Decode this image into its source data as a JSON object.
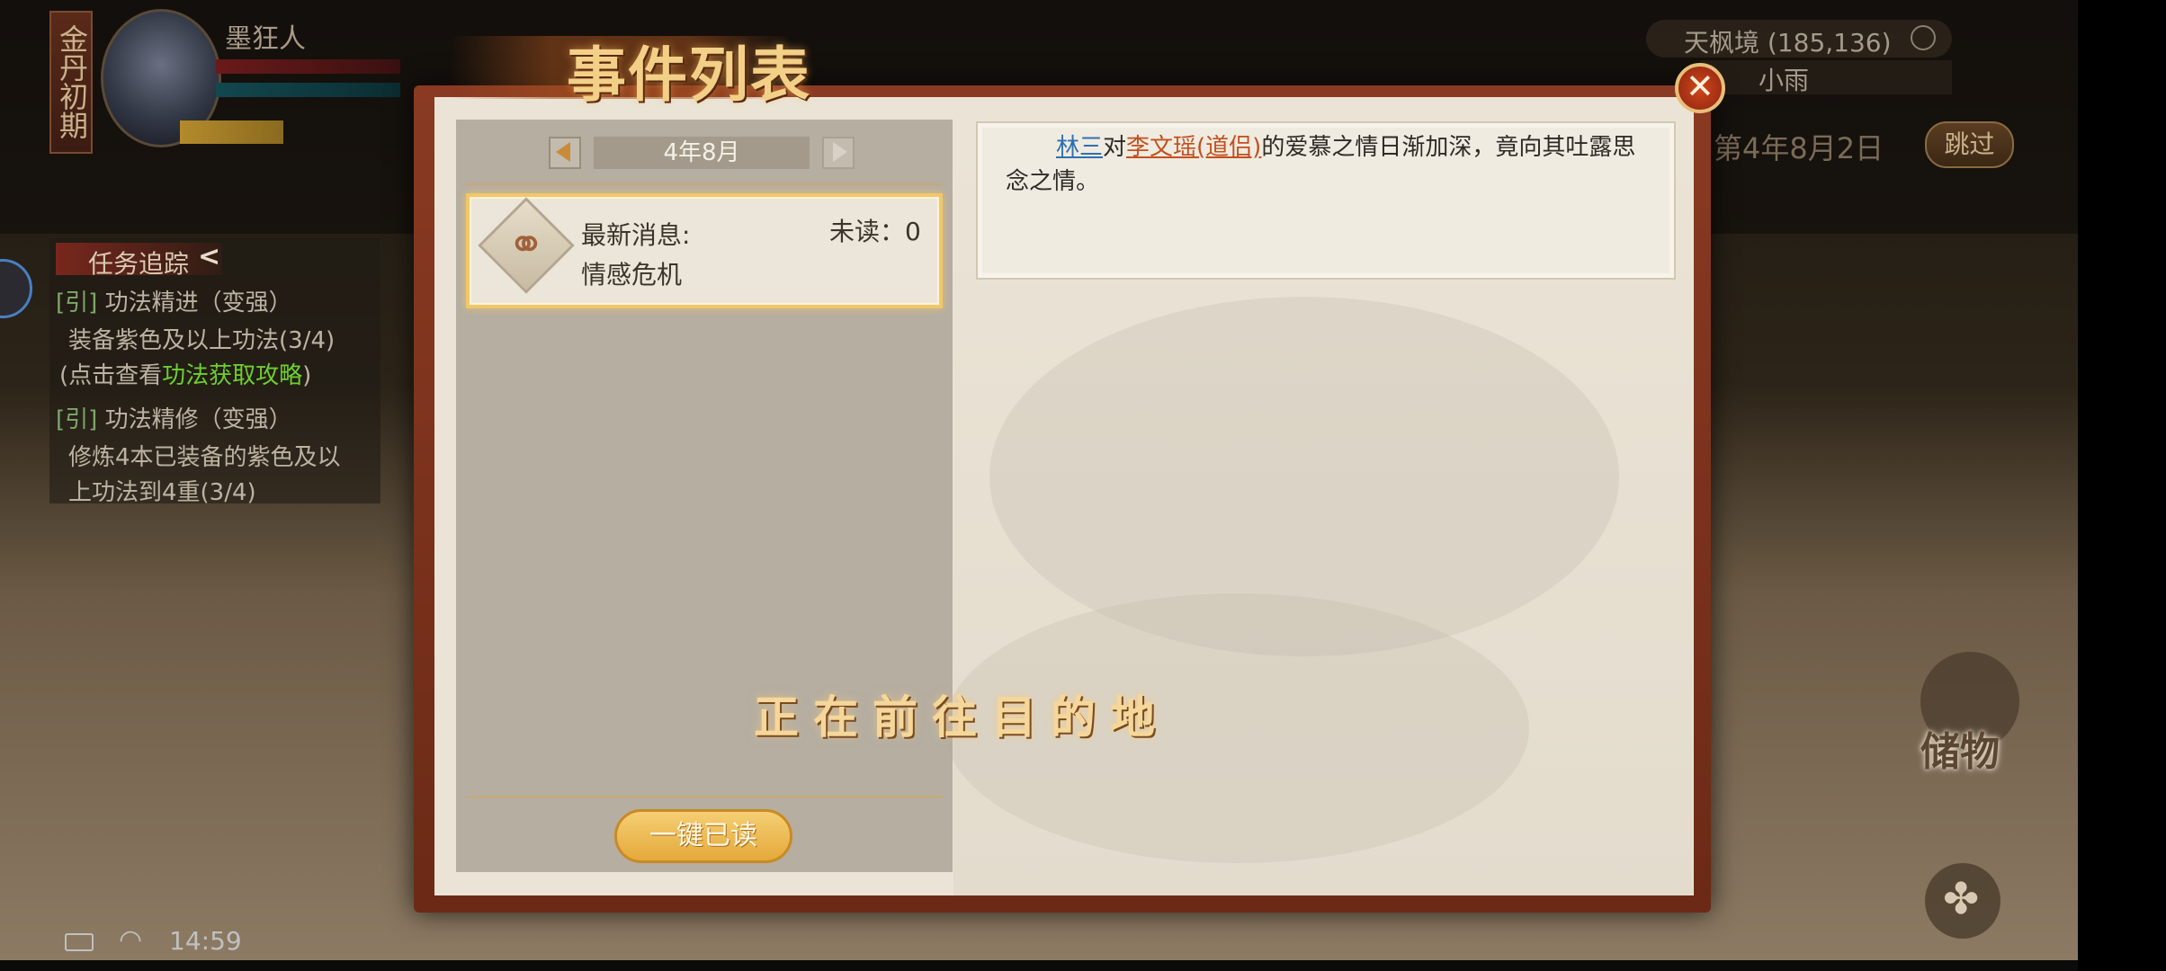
{
  "player": {
    "realm": "金丹初期",
    "name": "墨狂人"
  },
  "quests": {
    "title": "任务追踪",
    "items": [
      {
        "tag": "[引]",
        "name": "功法精进（变强）",
        "desc": "装备紫色及以上功法(3/4)",
        "hint_prefix": "(点击查看",
        "hint_link": "功法获取攻略",
        "hint_suffix": ")"
      },
      {
        "tag": "[引]",
        "name": "功法精修（变强）",
        "desc_line1": "修炼4本已装备的紫色及以",
        "desc_line2": "上功法到4重(3/4)"
      }
    ]
  },
  "hud": {
    "location": "天枫境 (185,136)",
    "weather": "小雨",
    "date": "第4年8月2日",
    "skip_label": "跳过",
    "storage_label": "储物"
  },
  "dialog": {
    "title": "事件列表",
    "month": "4年8月",
    "event": {
      "latest_label": "最新消息:",
      "unread_label": "未读：0",
      "name": "情感危机",
      "icon": "couple-icon"
    },
    "mark_all_read_label": "一键已读",
    "message": {
      "name1": "林三",
      "connector": "对",
      "name2": "李文瑶(道侣)",
      "rest": "的爱慕之情日渐加深，竟向其吐露思念之情。"
    }
  },
  "overlay": {
    "travel_text": "正在前往目的地"
  },
  "status_bar": {
    "time": "14:59"
  },
  "colors": {
    "name_blue": "#2f6fb3",
    "name_orange": "#c2501f",
    "title_gold": "#f3d087",
    "frame_red": "#8a3a22",
    "quest_link_green": "#6fcf2f"
  }
}
